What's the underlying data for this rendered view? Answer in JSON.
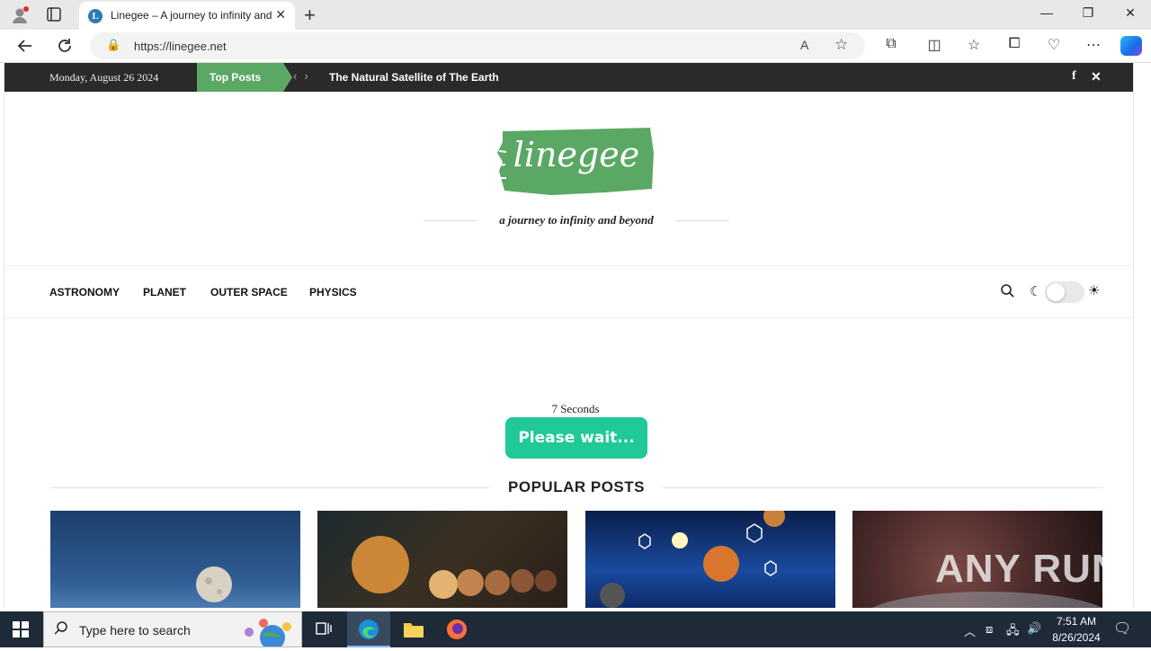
{
  "browser": {
    "tab_title": "Linegee – A journey to infinity and beyond",
    "tab_favicon_letter": "L",
    "url": "https://linegee.net"
  },
  "site": {
    "topbar": {
      "date": "Monday, August 26 2024",
      "top_posts_label": "Top Posts",
      "headline": "The Natural Satellite of The Earth"
    },
    "logo_text": "linegee",
    "tagline": "a journey to infinity and beyond",
    "nav": {
      "items": [
        "ASTRONOMY",
        "PLANET",
        "OUTER SPACE",
        "PHYSICS"
      ]
    },
    "countdown_text": "7 Seconds",
    "wait_button": "Please wait...",
    "popular_heading": "POPULAR POSTS",
    "watermark": "ANY RUN"
  },
  "colors": {
    "brand_green": "#5ba865",
    "button_green": "#20c997",
    "topbar_bg": "#2a2a2a",
    "taskbar_bg": "#1f2a38"
  },
  "taskbar": {
    "search_placeholder": "Type here to search",
    "time": "7:51 AM",
    "date": "8/26/2024"
  }
}
